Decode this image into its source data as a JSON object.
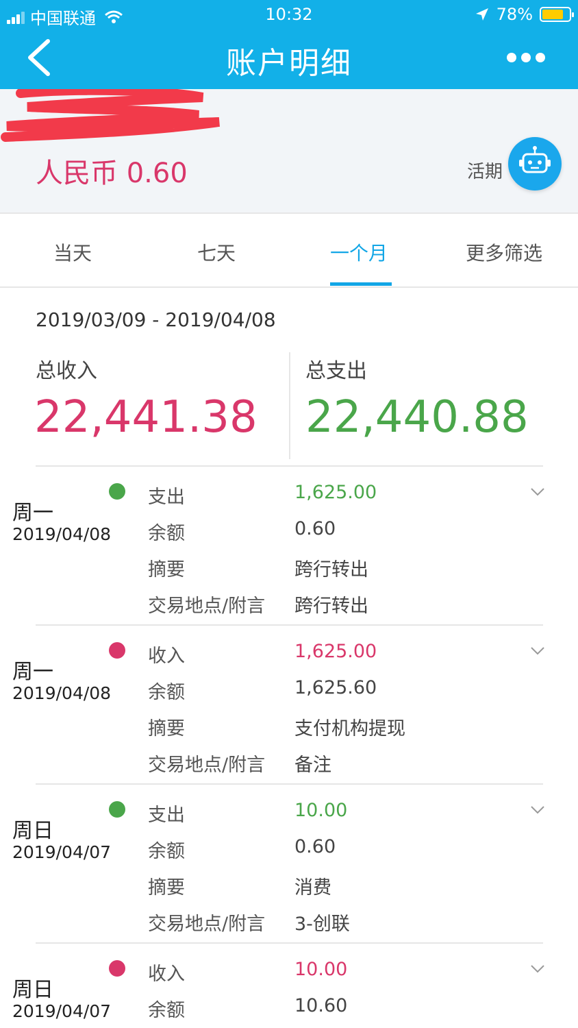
{
  "status_bar": {
    "carrier": "中国联通",
    "time": "10:32",
    "battery": "78%",
    "battery_level": 0.78
  },
  "nav": {
    "title": "账户明细",
    "back_icon": "chevron-left-icon",
    "more_icon": "more-dots-icon"
  },
  "account": {
    "balance": "人民币 0.60",
    "type_partial": "活期",
    "assistant_icon": "robot-icon"
  },
  "tabs": [
    {
      "label": "当天",
      "active": false
    },
    {
      "label": "七天",
      "active": false
    },
    {
      "label": "一个月",
      "active": true
    },
    {
      "label": "更多筛选",
      "active": false
    }
  ],
  "summary": {
    "date_range": "2019/03/09 - 2019/04/08",
    "income_label": "总收入",
    "income_value": "22,441.38",
    "expense_label": "总支出",
    "expense_value": "22,440.88"
  },
  "colors": {
    "brand": "#12b0e8",
    "income": "#d9376a",
    "expense": "#4aa64a"
  },
  "transactions": [
    {
      "weekday": "周一",
      "date": "2019/04/08",
      "kind": "expense",
      "type_label": "支出",
      "amount": "1,625.00",
      "balance_label": "余额",
      "balance": "0.60",
      "summary_label": "摘要",
      "summary": "跨行转出",
      "location_label": "交易地点/附言",
      "location": "跨行转出"
    },
    {
      "weekday": "周一",
      "date": "2019/04/08",
      "kind": "income",
      "type_label": "收入",
      "amount": "1,625.00",
      "balance_label": "余额",
      "balance": "1,625.60",
      "summary_label": "摘要",
      "summary": "支付机构提现",
      "location_label": "交易地点/附言",
      "location": "备注"
    },
    {
      "weekday": "周日",
      "date": "2019/04/07",
      "kind": "expense",
      "type_label": "支出",
      "amount": "10.00",
      "balance_label": "余额",
      "balance": "0.60",
      "summary_label": "摘要",
      "summary": "消费",
      "location_label": "交易地点/附言",
      "location": "3-创联"
    },
    {
      "weekday": "周日",
      "date": "2019/04/07",
      "kind": "income",
      "type_label": "收入",
      "amount": "10.00",
      "balance_label": "余额",
      "balance": "10.60"
    }
  ]
}
